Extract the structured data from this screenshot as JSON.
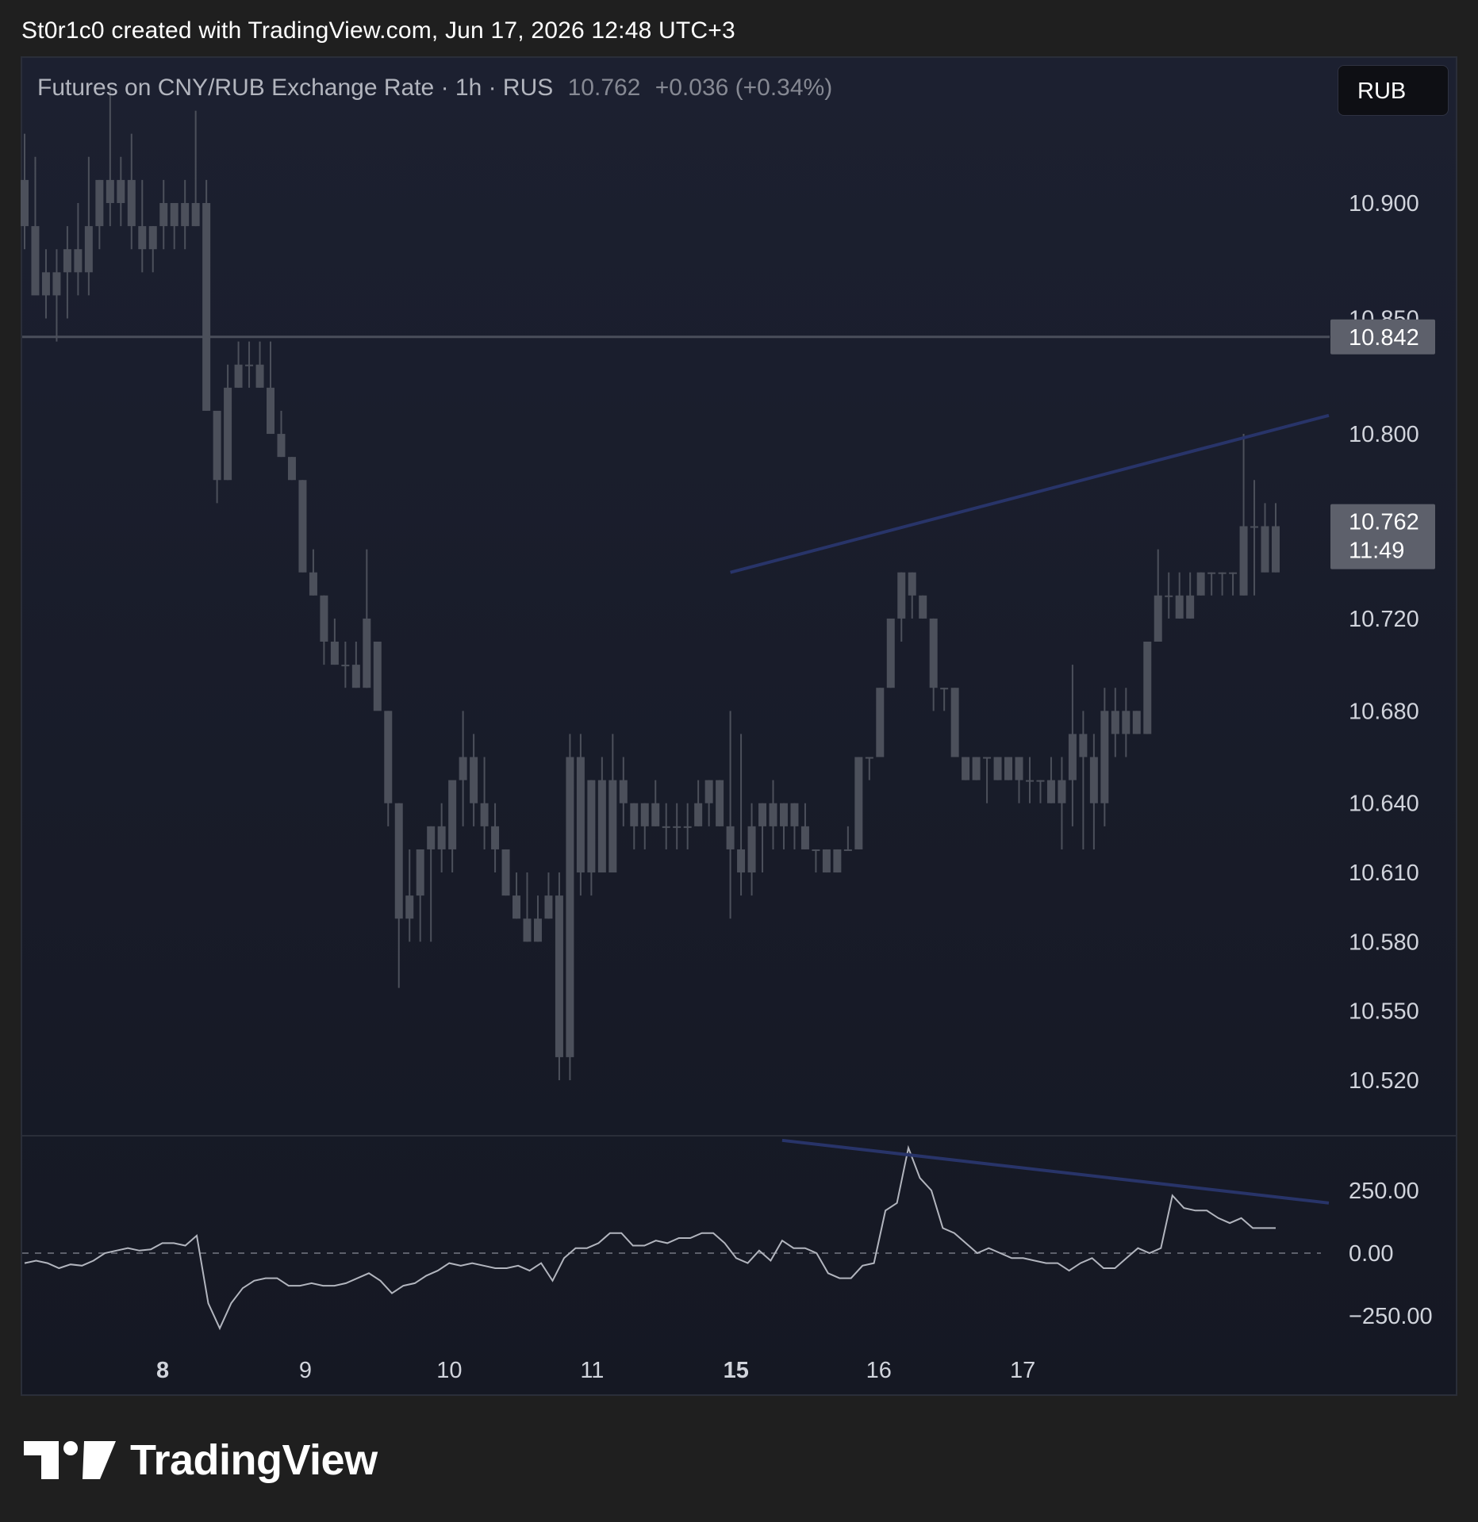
{
  "header": {
    "attribution": "St0r1c0 created with TradingView.com, Jun 17, 2026 12:48 UTC+3"
  },
  "legend": {
    "symbol": "Futures on CNY/RUB Exchange Rate · 1h · RUS",
    "last_price": "10.762",
    "change": "+0.036 (+0.34%)"
  },
  "currency_button": {
    "label": "RUB"
  },
  "footer": {
    "logo_text": "TradingView",
    "logo_icon": "tradingview-logo-icon"
  },
  "colors": {
    "candle": "#4c505b",
    "trendline": "#283469",
    "oscillator": "#b2b5be",
    "hline": "#4a4e5a",
    "hline_label_bg": "#5d606b",
    "last_price_label_bg": "#5d606b"
  },
  "chart_data": [
    {
      "type": "candlestick",
      "y_axis_ticks": [
        "10.900",
        "10.850",
        "10.800",
        "10.720",
        "10.680",
        "10.640",
        "10.610",
        "10.580",
        "10.550",
        "10.520"
      ],
      "x_axis_ticks": [
        "8",
        "9",
        "10",
        "11",
        "15",
        "16",
        "17"
      ],
      "x_axis_bold": [
        "8",
        "15"
      ],
      "horizontal_line": {
        "value": 10.842,
        "label": "10.842"
      },
      "last_price_label": {
        "value": 10.762,
        "price": "10.762",
        "countdown": "11:49"
      },
      "trendlines": [
        {
          "from": {
            "bar": 66,
            "value": 10.74
          },
          "to": {
            "bar": 112,
            "value": 10.808
          }
        }
      ],
      "candles": [
        [
          10.91,
          10.93,
          10.88,
          10.89
        ],
        [
          10.89,
          10.92,
          10.87,
          10.86
        ],
        [
          10.87,
          10.88,
          10.85,
          10.86
        ],
        [
          10.86,
          10.88,
          10.84,
          10.87
        ],
        [
          10.87,
          10.89,
          10.85,
          10.88
        ],
        [
          10.88,
          10.9,
          10.86,
          10.87
        ],
        [
          10.87,
          10.92,
          10.86,
          10.89
        ],
        [
          10.89,
          10.91,
          10.88,
          10.91
        ],
        [
          10.91,
          10.95,
          10.89,
          10.9
        ],
        [
          10.9,
          10.92,
          10.89,
          10.91
        ],
        [
          10.91,
          10.93,
          10.88,
          10.89
        ],
        [
          10.89,
          10.91,
          10.87,
          10.88
        ],
        [
          10.88,
          10.89,
          10.87,
          10.89
        ],
        [
          10.89,
          10.91,
          10.88,
          10.9
        ],
        [
          10.9,
          10.9,
          10.88,
          10.89
        ],
        [
          10.89,
          10.91,
          10.88,
          10.9
        ],
        [
          10.9,
          10.94,
          10.89,
          10.89
        ],
        [
          10.9,
          10.91,
          10.81,
          10.81
        ],
        [
          10.81,
          10.81,
          10.77,
          10.78
        ],
        [
          10.78,
          10.83,
          10.78,
          10.82
        ],
        [
          10.82,
          10.84,
          10.82,
          10.83
        ],
        [
          10.83,
          10.84,
          10.82,
          10.83
        ],
        [
          10.83,
          10.84,
          10.82,
          10.82
        ],
        [
          10.82,
          10.84,
          10.8,
          10.8
        ],
        [
          10.8,
          10.81,
          10.79,
          10.79
        ],
        [
          10.79,
          10.79,
          10.78,
          10.78
        ],
        [
          10.78,
          10.78,
          10.74,
          10.74
        ],
        [
          10.74,
          10.75,
          10.73,
          10.73
        ],
        [
          10.73,
          10.73,
          10.7,
          10.71
        ],
        [
          10.71,
          10.72,
          10.7,
          10.7
        ],
        [
          10.7,
          10.71,
          10.69,
          10.7
        ],
        [
          10.7,
          10.71,
          10.69,
          10.69
        ],
        [
          10.69,
          10.75,
          10.69,
          10.72
        ],
        [
          10.71,
          10.71,
          10.7,
          10.68
        ],
        [
          10.68,
          10.68,
          10.63,
          10.64
        ],
        [
          10.64,
          10.64,
          10.56,
          10.59
        ],
        [
          10.59,
          10.62,
          10.58,
          10.6
        ],
        [
          10.6,
          10.61,
          10.58,
          10.62
        ],
        [
          10.62,
          10.63,
          10.58,
          10.63
        ],
        [
          10.63,
          10.64,
          10.61,
          10.62
        ],
        [
          10.62,
          10.64,
          10.61,
          10.65
        ],
        [
          10.65,
          10.68,
          10.63,
          10.66
        ],
        [
          10.66,
          10.67,
          10.63,
          10.64
        ],
        [
          10.64,
          10.66,
          10.62,
          10.63
        ],
        [
          10.63,
          10.64,
          10.61,
          10.62
        ],
        [
          10.62,
          10.62,
          10.6,
          10.6
        ],
        [
          10.6,
          10.61,
          10.59,
          10.59
        ],
        [
          10.59,
          10.61,
          10.58,
          10.58
        ],
        [
          10.58,
          10.6,
          10.58,
          10.59
        ],
        [
          10.59,
          10.61,
          10.59,
          10.6
        ],
        [
          10.6,
          10.61,
          10.52,
          10.53
        ],
        [
          10.53,
          10.67,
          10.52,
          10.66
        ],
        [
          10.66,
          10.67,
          10.6,
          10.61
        ],
        [
          10.61,
          10.65,
          10.6,
          10.65
        ],
        [
          10.65,
          10.66,
          10.61,
          10.61
        ],
        [
          10.61,
          10.67,
          10.61,
          10.65
        ],
        [
          10.65,
          10.66,
          10.63,
          10.64
        ],
        [
          10.64,
          10.64,
          10.62,
          10.63
        ],
        [
          10.63,
          10.64,
          10.62,
          10.64
        ],
        [
          10.64,
          10.65,
          10.63,
          10.63
        ],
        [
          10.63,
          10.64,
          10.62,
          10.63
        ],
        [
          10.63,
          10.64,
          10.62,
          10.63
        ],
        [
          10.63,
          10.64,
          10.62,
          10.63
        ],
        [
          10.63,
          10.65,
          10.63,
          10.64
        ],
        [
          10.64,
          10.65,
          10.63,
          10.65
        ],
        [
          10.65,
          10.65,
          10.63,
          10.63
        ],
        [
          10.63,
          10.68,
          10.59,
          10.62
        ],
        [
          10.62,
          10.67,
          10.6,
          10.61
        ],
        [
          10.61,
          10.64,
          10.6,
          10.63
        ],
        [
          10.63,
          10.64,
          10.61,
          10.64
        ],
        [
          10.64,
          10.65,
          10.62,
          10.63
        ],
        [
          10.63,
          10.64,
          10.62,
          10.64
        ],
        [
          10.64,
          10.64,
          10.62,
          10.63
        ],
        [
          10.63,
          10.64,
          10.62,
          10.62
        ],
        [
          10.62,
          10.62,
          10.61,
          10.62
        ],
        [
          10.62,
          10.62,
          10.61,
          10.61
        ],
        [
          10.61,
          10.62,
          10.61,
          10.62
        ],
        [
          10.62,
          10.63,
          10.62,
          10.62
        ],
        [
          10.62,
          10.66,
          10.62,
          10.66
        ],
        [
          10.66,
          10.66,
          10.65,
          10.66
        ],
        [
          10.66,
          10.69,
          10.66,
          10.69
        ],
        [
          10.69,
          10.71,
          10.69,
          10.72
        ],
        [
          10.72,
          10.74,
          10.71,
          10.74
        ],
        [
          10.74,
          10.74,
          10.72,
          10.73
        ],
        [
          10.73,
          10.73,
          10.72,
          10.72
        ],
        [
          10.72,
          10.72,
          10.68,
          10.69
        ],
        [
          10.69,
          10.69,
          10.68,
          10.69
        ],
        [
          10.69,
          10.69,
          10.66,
          10.66
        ],
        [
          10.66,
          10.66,
          10.65,
          10.65
        ],
        [
          10.65,
          10.66,
          10.65,
          10.66
        ],
        [
          10.66,
          10.66,
          10.64,
          10.66
        ],
        [
          10.66,
          10.66,
          10.65,
          10.65
        ],
        [
          10.65,
          10.66,
          10.65,
          10.66
        ],
        [
          10.66,
          10.66,
          10.64,
          10.65
        ],
        [
          10.65,
          10.66,
          10.64,
          10.65
        ],
        [
          10.65,
          10.65,
          10.64,
          10.65
        ],
        [
          10.65,
          10.66,
          10.64,
          10.64
        ],
        [
          10.64,
          10.66,
          10.62,
          10.65
        ],
        [
          10.65,
          10.7,
          10.63,
          10.67
        ],
        [
          10.67,
          10.68,
          10.62,
          10.66
        ],
        [
          10.66,
          10.67,
          10.62,
          10.64
        ],
        [
          10.64,
          10.69,
          10.63,
          10.68
        ],
        [
          10.68,
          10.69,
          10.66,
          10.67
        ],
        [
          10.67,
          10.69,
          10.66,
          10.68
        ],
        [
          10.68,
          10.68,
          10.67,
          10.67
        ],
        [
          10.67,
          10.71,
          10.67,
          10.71
        ],
        [
          10.71,
          10.75,
          10.71,
          10.73
        ],
        [
          10.73,
          10.74,
          10.72,
          10.73
        ],
        [
          10.73,
          10.74,
          10.72,
          10.72
        ],
        [
          10.72,
          10.74,
          10.72,
          10.73
        ],
        [
          10.73,
          10.74,
          10.73,
          10.74
        ],
        [
          10.74,
          10.74,
          10.73,
          10.74
        ],
        [
          10.74,
          10.74,
          10.73,
          10.74
        ],
        [
          10.74,
          10.74,
          10.73,
          10.74
        ],
        [
          10.73,
          10.8,
          10.73,
          10.76
        ],
        [
          10.76,
          10.78,
          10.73,
          10.76
        ],
        [
          10.76,
          10.77,
          10.74,
          10.74
        ],
        [
          10.74,
          10.77,
          10.74,
          10.76
        ]
      ],
      "note_candles_format": "[open, high, low, close]"
    },
    {
      "type": "line",
      "name": "",
      "y_axis_ticks": [
        "250.00",
        "0.00",
        "−250.00"
      ],
      "zero_line": 0,
      "values": [
        -40,
        -30,
        -40,
        -60,
        -45,
        -50,
        -30,
        0,
        10,
        20,
        10,
        15,
        40,
        40,
        30,
        70,
        -200,
        -300,
        -200,
        -140,
        -110,
        -100,
        -100,
        -130,
        -130,
        -120,
        -130,
        -130,
        -120,
        -100,
        -80,
        -110,
        -160,
        -130,
        -120,
        -90,
        -70,
        -40,
        -50,
        -40,
        -50,
        -60,
        -60,
        -50,
        -70,
        -40,
        -110,
        -20,
        20,
        20,
        40,
        80,
        80,
        30,
        30,
        50,
        40,
        60,
        60,
        80,
        80,
        40,
        -20,
        -40,
        10,
        -30,
        50,
        20,
        20,
        0,
        -80,
        -100,
        -100,
        -50,
        -40,
        170,
        200,
        420,
        300,
        250,
        100,
        80,
        40,
        0,
        20,
        0,
        -20,
        -20,
        -30,
        -40,
        -40,
        -70,
        -40,
        -20,
        -60,
        -60,
        -20,
        20,
        0,
        20,
        230,
        180,
        170,
        170,
        140,
        120,
        140,
        100,
        100,
        100
      ],
      "trendlines": [
        {
          "from": {
            "bar": 66,
            "value": 450
          },
          "to": {
            "bar": 112,
            "value": 200
          }
        }
      ]
    }
  ]
}
